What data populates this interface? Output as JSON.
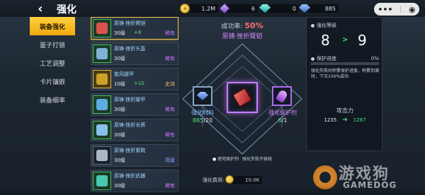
{
  "header": {
    "back_icon": "back-arrow-icon",
    "title": "强化",
    "currencies": [
      {
        "icon": "gold-coin-icon",
        "value": "1.2M"
      },
      {
        "icon": "purple-crystal-icon",
        "value": "6"
      },
      {
        "icon": "teal-gem-icon",
        "value": "0"
      },
      {
        "icon": "blue-gem-icon",
        "value": "885"
      }
    ],
    "system_menu_icon": "more-dots-icon",
    "system_close_icon": "target-close-icon"
  },
  "nav": {
    "items": [
      {
        "label": "装备强化",
        "active": true
      },
      {
        "label": "量子打锁",
        "active": false
      },
      {
        "label": "工艺调整",
        "active": false
      },
      {
        "label": "卡片镶嵌",
        "active": false
      },
      {
        "label": "装备细率",
        "active": false
      }
    ]
  },
  "list": {
    "items": [
      {
        "name": "原铸·挫折臂铠",
        "level": "30级",
        "plus": "+8",
        "rarity": "稀有",
        "rarity_type": "purple",
        "frame": "green",
        "selected": true,
        "art": "#d9534f"
      },
      {
        "name": "原铸·挫折头盔",
        "level": "30级",
        "plus": "",
        "rarity": "稀有",
        "rarity_type": "purple",
        "frame": "green",
        "selected": false,
        "art": "#7fb3d5"
      },
      {
        "name": "旋风腿甲",
        "level": "10级",
        "plus": "+10",
        "rarity": "史诗",
        "rarity_type": "gold",
        "frame": "gold",
        "selected": false,
        "art": "#c9a227"
      },
      {
        "name": "原铸·挫折腿甲",
        "level": "30级",
        "plus": "",
        "rarity": "稀有",
        "rarity_type": "purple",
        "frame": "green",
        "selected": false,
        "art": "#5dade2"
      },
      {
        "name": "原铸·挫折长裤",
        "level": "30级",
        "plus": "",
        "rarity": "稀有",
        "rarity_type": "purple",
        "frame": "green",
        "selected": false,
        "art": "#85c1e9"
      },
      {
        "name": "原铸·挫折重靴",
        "level": "30级",
        "plus": "",
        "rarity": "高级",
        "rarity_type": "blue",
        "frame": "plain",
        "selected": false,
        "art": "#aab7c4"
      },
      {
        "name": "原铸·挫折武器",
        "level": "30级",
        "plus": "",
        "rarity": "稀有",
        "rarity_type": "purple",
        "frame": "green",
        "selected": false,
        "art": "#48c9b0"
      }
    ]
  },
  "center": {
    "rate_label": "成功率:",
    "rate_value": "50%",
    "item_title": "原铸·挫折臂铠",
    "left_slot": {
      "label": "强化材料",
      "count": "885",
      "max": "20",
      "icon": "blue-gem-icon"
    },
    "center_slot": {
      "icon": "armor-gauntlet-icon"
    },
    "right_slot": {
      "label": "强化保护剂",
      "count": "6",
      "max": "1",
      "icon": "protect-potion-icon"
    },
    "use_protect": "使用保护剂",
    "fail_note": "强化失败不掉级",
    "cost_label": "强化费用:",
    "cost_value": "10.0K"
  },
  "panel": {
    "level_title": "强化等级",
    "level_from": "8",
    "level_to": "9",
    "protect_title": "保护进度",
    "protect_value": "0%",
    "protect_fraction": 0,
    "note": "强化失败时积累保护进度，积累到满时，下次100%成功",
    "atk_title": "攻击力",
    "atk_from": "1235",
    "atk_to": "1287"
  },
  "watermark": {
    "text": "游戏狗",
    "sub": "GAMEDOG",
    "brand_color": "#f08a1c"
  },
  "colors": {
    "accent_gold": "#f2a90c",
    "rate_red": "#ff6e6e",
    "rare_purple": "#c97bff",
    "up_green": "#3fe07a"
  }
}
